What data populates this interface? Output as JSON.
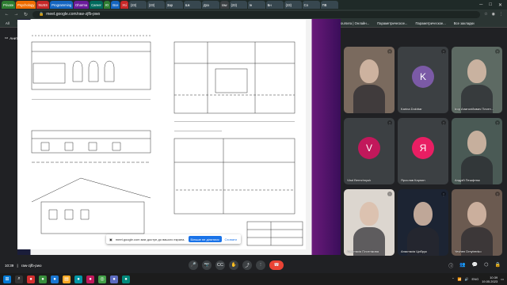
{
  "tabs": [
    {
      "label": "Private",
      "color": "g"
    },
    {
      "label": "Psychology",
      "color": "o"
    },
    {
      "label": "NUSS",
      "color": "r"
    },
    {
      "label": "Programming",
      "color": "b"
    },
    {
      "label": "Dharma",
      "color": "p"
    },
    {
      "label": "Career",
      "color": "t"
    },
    {
      "label": "Ю",
      "color": "g"
    },
    {
      "label": "Все",
      "color": "b"
    },
    {
      "label": "Усі",
      "color": "r"
    },
    {
      "label": "(23)",
      "color": "dk"
    },
    {
      "label": "(23)",
      "color": "dk"
    },
    {
      "label": "Зар",
      "color": "dk"
    },
    {
      "label": "Шк",
      "color": "dk"
    },
    {
      "label": "Доз",
      "color": "dk"
    },
    {
      "label": "raw",
      "color": "active"
    },
    {
      "label": "(23)",
      "color": "dk"
    },
    {
      "label": "Ін",
      "color": "dk"
    },
    {
      "label": "Бн",
      "color": "dk"
    },
    {
      "label": "(23)",
      "color": "dk"
    },
    {
      "label": "Со",
      "color": "dk"
    },
    {
      "label": "ПВ",
      "color": "dk"
    }
  ],
  "address": {
    "url": "meet.google.com/raw-zjfb-pwo"
  },
  "bookmarks": [
    {
      "label": "All",
      "chip": ""
    },
    {
      "label": "Best_ERM",
      "chip": ""
    },
    {
      "label": "Private",
      "chip": "g"
    },
    {
      "label": "Programming",
      "chip": "b"
    },
    {
      "label": "NUSS",
      "chip": "r"
    },
    {
      "label": "Dharma",
      "chip": "p"
    },
    {
      "label": "LiRA",
      "chip": "o"
    },
    {
      "label": "Career",
      "chip": "t"
    },
    {
      "label": "Psychology",
      "chip": "o"
    },
    {
      "label": "Mathpad.ru",
      "chip": ""
    },
    {
      "label": "Строим дом",
      "chip": ""
    },
    {
      "label": "Буданчокта",
      "chip": ""
    },
    {
      "label": "Перакладанне - Дз...",
      "chip": ""
    },
    {
      "label": "НН 61 Реталыкова...",
      "chip": ""
    },
    {
      "label": "Coursera | Онлайн...",
      "chip": ""
    },
    {
      "label": "Параметрическое...",
      "chip": ""
    },
    {
      "label": "Параметрическое...",
      "chip": ""
    },
    {
      "label": "Все закладки",
      "chip": ""
    }
  ],
  "meet": {
    "presenter": "Анета Никогорвенко (Презентація)",
    "banner": {
      "text": "meet.google.com має доступ до вашого екрана.",
      "stop": "Більше не ділитися",
      "hide": "Сховати"
    },
    "clock": "10:39",
    "code": "raw-zjfb-pwo",
    "participants": [
      {
        "name": "",
        "initial": "",
        "color": "#7a6a5e",
        "video": true
      },
      {
        "name": "Karina Dokhtar",
        "initial": "K",
        "color": "#7b5aa6",
        "video": false
      },
      {
        "name": "Ігор Анатолійович Плотн...",
        "initial": "",
        "color": "#5d6a63",
        "video": true
      },
      {
        "name": "Vlad Berezhnyuk",
        "initial": "V",
        "color": "#c2185b",
        "video": false
      },
      {
        "name": "Ярослав Карпин",
        "initial": "Я",
        "color": "#e91e63",
        "video": false
      },
      {
        "name": "Андрій Пешфтюк",
        "initial": "",
        "color": "#4a5a55",
        "video": true
      },
      {
        "name": "Анастасія Плотнікова",
        "initial": "",
        "color": "#dcd6cf",
        "video": true
      },
      {
        "name": "Анастасія Цибрук",
        "initial": "",
        "color": "#1c2433",
        "video": true
      },
      {
        "name": "Yevhen Dmytrenko",
        "initial": "",
        "color": "#6b5a50",
        "video": true
      }
    ]
  },
  "taskbar": {
    "lang": "ENG",
    "time": "10:39",
    "date": "19.05.2023"
  }
}
